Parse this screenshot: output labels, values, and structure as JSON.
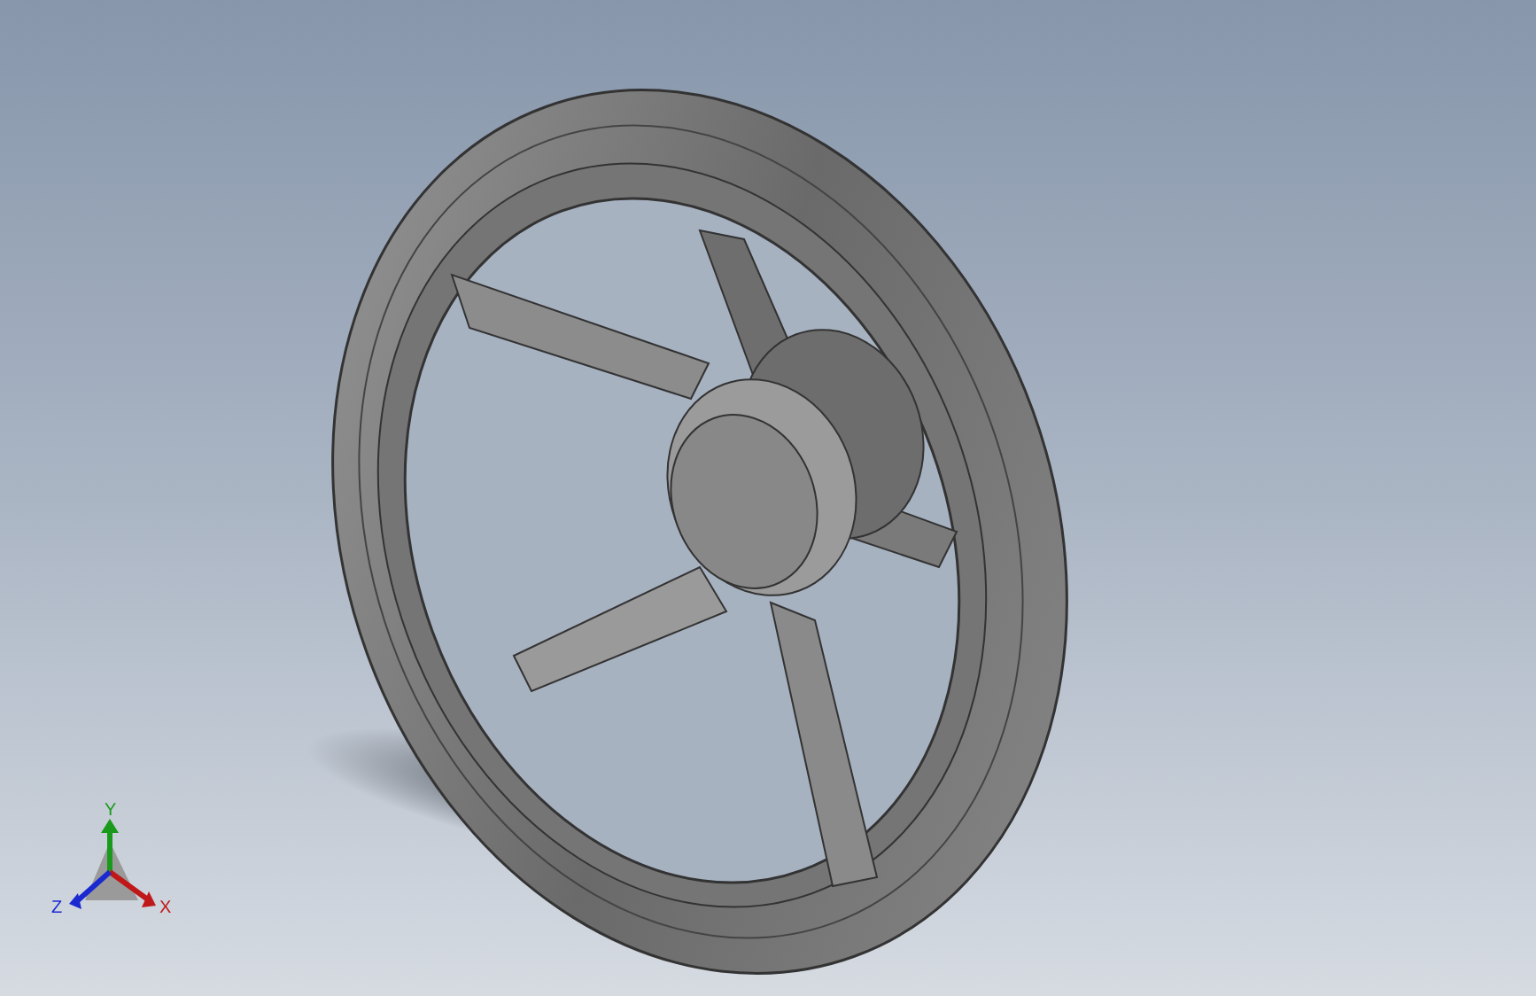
{
  "viewport": {
    "triad": {
      "y_label": "Y",
      "z_label": "Z",
      "x_label": "X"
    }
  }
}
